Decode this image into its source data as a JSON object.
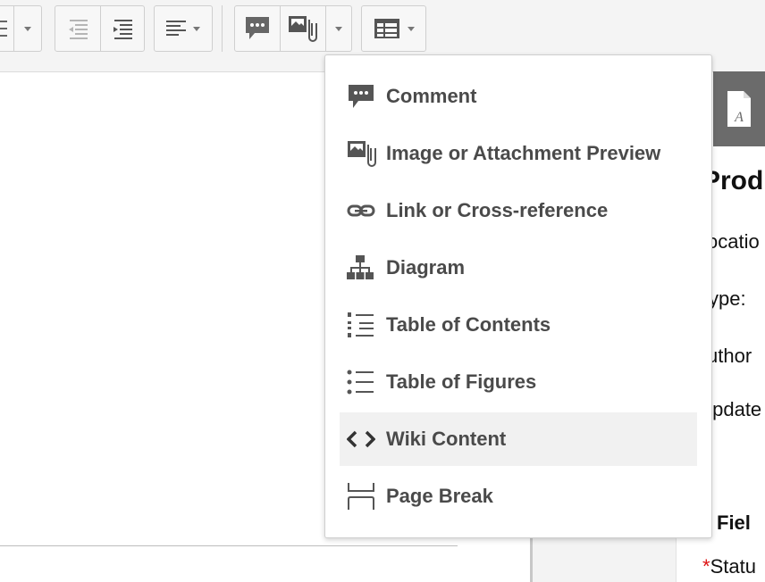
{
  "menu": {
    "items": [
      {
        "label": "Comment",
        "icon": "comment-icon"
      },
      {
        "label": "Image or Attachment Preview",
        "icon": "image-attachment-icon"
      },
      {
        "label": "Link or Cross-reference",
        "icon": "link-icon"
      },
      {
        "label": "Diagram",
        "icon": "diagram-icon"
      },
      {
        "label": "Table of Contents",
        "icon": "table-of-contents-icon"
      },
      {
        "label": "Table of Figures",
        "icon": "table-of-figures-icon"
      },
      {
        "label": "Wiki Content",
        "icon": "code-icon"
      },
      {
        "label": "Page Break",
        "icon": "page-break-icon"
      }
    ]
  },
  "panel": {
    "title": "Prod",
    "location": "ocatio",
    "type": "ype:",
    "author": "uthor",
    "updated": "Ipdate",
    "fields_heading": "Fiel",
    "status": "Statu",
    "required_mark": "*"
  },
  "colors": {
    "menu_text": "#4a4a4a",
    "icon": "#555555",
    "toolbar_bg": "#f4f4f4",
    "highlight": "#f1f1f1"
  }
}
